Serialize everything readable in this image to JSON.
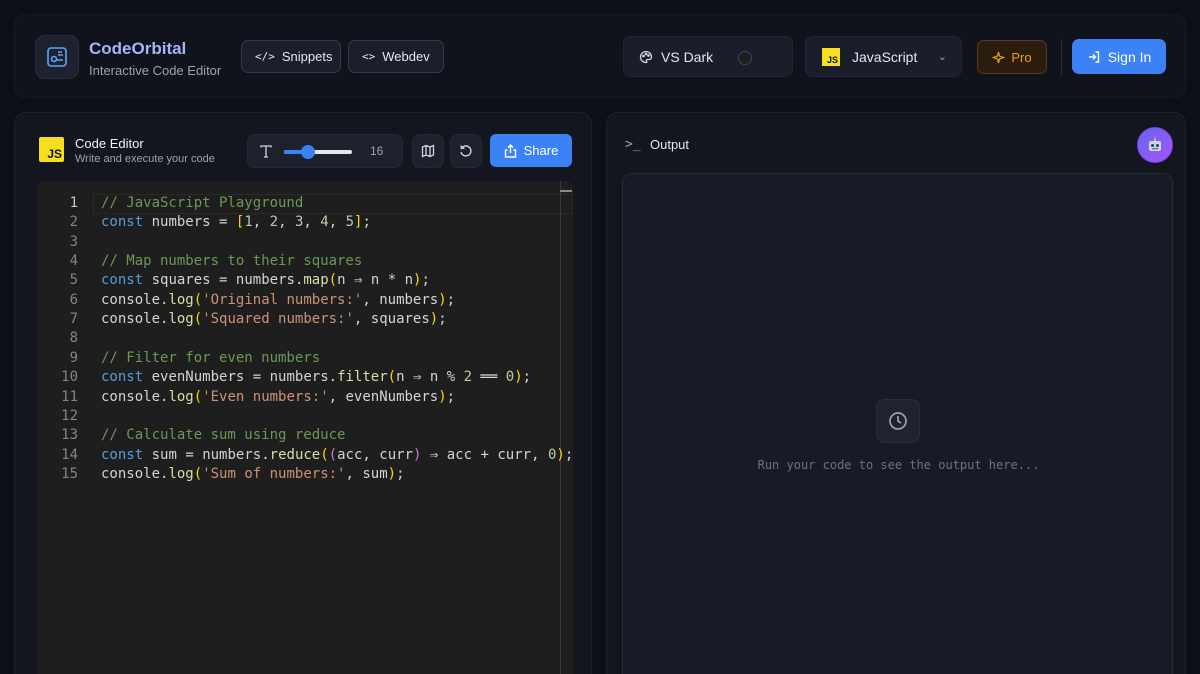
{
  "header": {
    "brand_name": "CodeOrbital",
    "brand_sub": "Interactive Code Editor",
    "snippets_label": "Snippets",
    "webdev_label": "Webdev",
    "theme_label": "VS Dark",
    "language_label": "JavaScript",
    "language_badge": "JS",
    "pro_label": "Pro",
    "signin_label": "Sign In"
  },
  "editor": {
    "badge": "JS",
    "title": "Code Editor",
    "subtitle": "Write and execute your code",
    "font_size": "16",
    "font_size_fraction": 0.35,
    "share_label": "Share",
    "lines": [
      "1",
      "2",
      "3",
      "4",
      "5",
      "6",
      "7",
      "8",
      "9",
      "10",
      "11",
      "12",
      "13",
      "14",
      "15"
    ],
    "code": [
      "// JavaScript Playground",
      "const numbers = [1, 2, 3, 4, 5];",
      "",
      "// Map numbers to their squares",
      "const squares = numbers.map(n => n * n);",
      "console.log('Original numbers:', numbers);",
      "console.log('Squared numbers:', squares);",
      "",
      "// Filter for even numbers",
      "const evenNumbers = numbers.filter(n => n % 2 === 0);",
      "console.log('Even numbers:', evenNumbers);",
      "",
      "// Calculate sum using reduce",
      "const sum = numbers.reduce((acc, curr) => acc + curr, 0);",
      "console.log('Sum of numbers:', sum);"
    ]
  },
  "output": {
    "title": "Output",
    "hint": "Run your code to see the output here..."
  },
  "colors": {
    "accent": "#3b82f6",
    "pro": "#f59e0b",
    "brand": "#a5b4fc",
    "js_yellow": "#f7df1e"
  }
}
